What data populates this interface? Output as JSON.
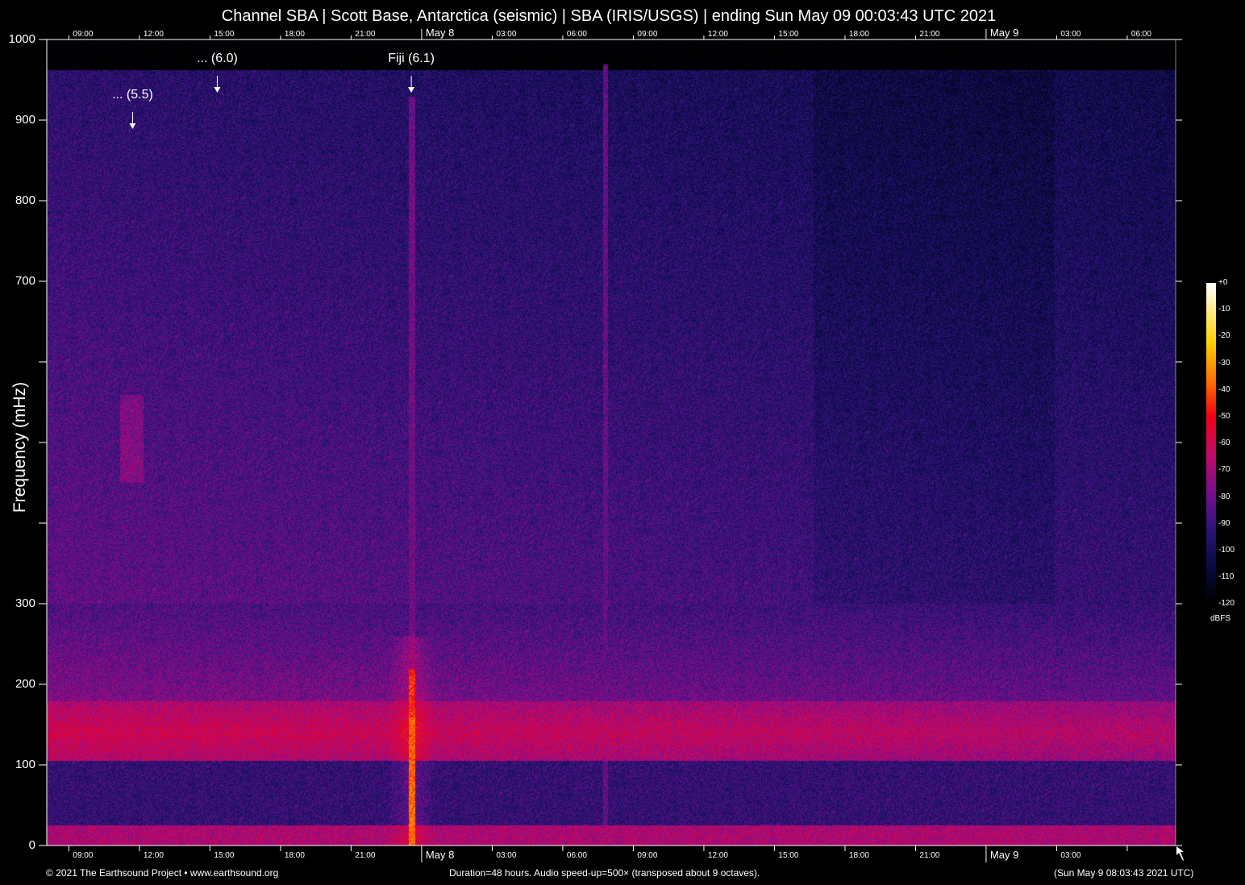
{
  "chart_data": {
    "type": "heatmap",
    "title": "Channel SBA | Scott Base, Antarctica (seismic) | SBA (IRIS/USGS) | ending Sun May 09 00:03:43 UTC 2021",
    "ylabel": "Frequency (mHz)",
    "ylim": [
      0,
      1000
    ],
    "y_ticks": [
      0,
      100,
      200,
      300,
      400,
      500,
      600,
      700,
      800,
      900,
      1000
    ],
    "y_tick_labels": [
      "0",
      "100",
      "200",
      "300",
      "",
      "",
      "",
      "700",
      "800",
      "900",
      "1000"
    ],
    "x_range_hours": [
      0,
      48
    ],
    "x_start_offset_hours": 0.94,
    "x_ticks_top": [
      "09:00",
      "12:00",
      "15:00",
      "18:00",
      "21:00",
      "May  8",
      "03:00",
      "06:00",
      "09:00",
      "12:00",
      "15:00",
      "18:00",
      "21:00",
      "May  9",
      "03:00",
      "06:00"
    ],
    "x_ticks_bottom": [
      "09:00",
      "12:00",
      "15:00",
      "18:00",
      "21:00",
      "May  8",
      "03:00",
      "06:00",
      "09:00",
      "12:00",
      "15:00",
      "18:00",
      "21:00",
      "May  9",
      "03:00",
      ""
    ],
    "annotations": [
      {
        "label": "... (5.5)",
        "hour": 3.65,
        "freq": 890
      },
      {
        "label": "... (6.0)",
        "hour": 7.25,
        "freq": 935
      },
      {
        "label": "Fiji (6.1)",
        "hour": 15.5,
        "freq": 935
      }
    ],
    "colorbar": {
      "label": "dBFS",
      "range": [
        -120,
        0
      ],
      "ticks": [
        "+0",
        "-10",
        "-20",
        "-30",
        "-40",
        "-50",
        "-60",
        "-70",
        "-80",
        "-90",
        "-100",
        "-110",
        "-120"
      ]
    }
  },
  "footer": {
    "left": "© 2021 The Earthsound Project • www.earthsound.org",
    "center": "Duration=48 hours. Audio speed-up=500× (transposed about 9 octaves).",
    "right": "(Sun May  9 08:03:43 2021 UTC)"
  }
}
